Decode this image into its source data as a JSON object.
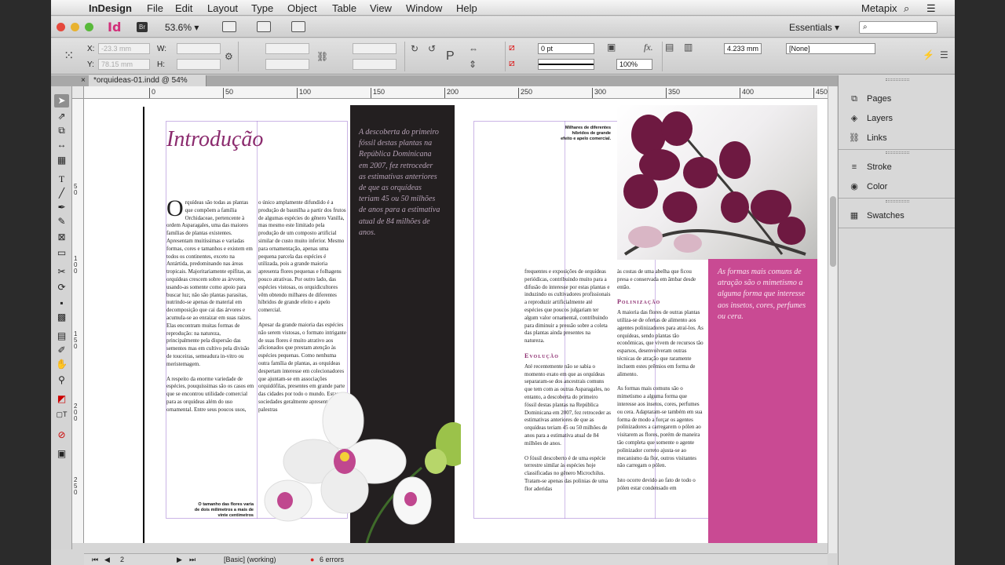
{
  "menubar": {
    "app": "InDesign",
    "items": [
      "File",
      "Edit",
      "Layout",
      "Type",
      "Object",
      "Table",
      "View",
      "Window",
      "Help"
    ],
    "right_app": "Metapix"
  },
  "appbar": {
    "logo": "Id",
    "bridge": "Br",
    "zoom": "53.6%",
    "workspace": "Essentials"
  },
  "control": {
    "x_label": "X:",
    "x_value": "-23.3 mm",
    "y_label": "Y:",
    "y_value": "78.15 mm",
    "w_label": "W:",
    "h_label": "H:",
    "stroke_weight": "0 pt",
    "opacity": "100%",
    "dimension": "4.233 mm",
    "object_style": "[None]"
  },
  "document_tab": "*orquideas-01.indd @ 54%",
  "ruler": {
    "h_ticks": [
      "0",
      "50",
      "100",
      "150",
      "200",
      "250",
      "300",
      "350",
      "400",
      "450"
    ],
    "v_ticks": [
      "5\n0",
      "1\n0\n0",
      "1\n5\n0",
      "2\n0\n0",
      "2\n5\n0"
    ]
  },
  "spread": {
    "title": "Introdução",
    "col1_p1": "rquídeas são todas as plantas que compõem a família Orchidaceae, pertencente à ordem Asparagales, uma das maiores famílias de plantas existentes. Apresentam muitíssimas e variadas formas, cores e tamanhos e existem em todos os continentes, exceto na Antártida, predominando nas áreas tropicais. Majoritariamente epífitas, as orquídeas crescem sobre as árvores, usando-as somente como apoio para buscar luz; não são plantas parasitas, nutrindo-se apenas de material em decomposição que cai das árvores e acumula-se ao enraizar em suas raízes. Elas encontram muitas formas de reprodução: na natureza, principalmente pela dispersão das sementes mas em cultivo pela divisão de touceiras, semeadura in-vitro ou meristemagem.",
    "col1_p2": "A respeito da enorme variedade de espécies, pouquíssimas são os casos em que se encontrou utilidade comercial para as orquídeas além do uso ornamental. Entre seus poucos usos,",
    "col2_p1": "o único amplamente difundido é a produção de baunilha a partir dos frutos de algumas espécies do gênero Vanilla, mas mesmo este limitado pela produção de um composto artificial similar de custo muito inferior. Mesmo para ornamentação, apenas uma pequena parcela das espécies é utilizada, pois a grande maioria apresenta flores pequenas e folhagens pouco atrativas. Por outro lado, das espécies vistosas, os orquidicultores vêm obtendo milhares de diferentes híbridos de grande efeito e apelo comercial.",
    "col2_p2": "Apesar da grande maioria das espécies não serem vistosas, o formato intrigante de suas flores é muito atrativo aos aficionados que prestam atenção às espécies pequenas. Como nenhuma outra família de plantas, as orquídeas despertam interesse em colecionadores que ajuntam-se em associações orquidófilas, presentes em grande parte das cidades por todo o mundo. Estas sociedades geralmente apresentam palestras",
    "caption_left": "O tamanho das flores varia de dois milímetros a mais de vinte centímetros",
    "quote1": "A descoberta do primeiro fóssil destas plantas na República Dominicana em 2007, fez retroceder as estimativas anteriores de que as orquídeas teriam 45 ou 50 milhões de anos para a estimativa atual de 84 milhões de anos.",
    "caption_right": "Milhares de diferentes híbridos de grande efeito e apelo comercial.",
    "col3_p1": "frequentes e exposições de orquídeas periódicas, contribuindo muito para a difusão do interesse por estas plantas e induzindo os cultivadores profissionais a reproduzir artificialmente até espécies que poucos julgariam ter algum valor ornamental, contribuindo para diminuir a pressão sobre a coleta das plantas ainda presentes na natureza.",
    "col3_head": "Evolução",
    "col3_p2": "Até recentemente não se sabia o momento exato em que as orquídeas separaram-se dos ancestrais comuns que tem com as outras Asparagales, no entanto, a descoberta do primeiro fóssil destas plantas na República Dominicana em 2007, fez retroceder as estimativas anteriores de que as orquídeas teriam 45 ou 50 milhões de anos para a estimativa atual de 84 milhões de anos.",
    "col3_p3": "O fóssil descoberto é de uma espécie terrestre similar às espécies hoje classificadas no gênero Microchilus. Tratam-se apenas das polinias de uma flor aderidas",
    "col4_p1": "às costas de uma abelha que ficou presa e conservada em âmbar desde então.",
    "col4_head": "Polinização",
    "col4_p2": "A maioria das flores de outras plantas utiliza-se de ofertas de alimento aos agentes polinizadores para atraí-los. As orquídeas, sendo plantas tão econômicas, que vivem de recursos tão esparsos, desenvolveram outras técnicas de atração que raramente incluem estes prêmios em forma de alimento.",
    "col4_p3": "As formas mais comuns são o mimetismo a alguma forma que interesse aos insetos, cores, perfumes ou cera. Adaptaram-se também em sua forma de modo a forçar os agentes polinizadores a carregarem o pólen ao visitarem as flores, porém de maneira tão completa que somente o agente polinizador correto ajusta-se ao mecanismo da flor, outros visitantes não carregam o pólen.",
    "col4_p4": "Isto ocorre devido ao fato de todo o pólen estar condensado em",
    "quote2": "As formas mais comuns de atração são o mimetismo a alguma forma que interesse aos insetos, cores, perfumes ou cera."
  },
  "status": {
    "page": "2",
    "preflight_profile": "[Basic] (working)",
    "errors": "6 errors"
  },
  "panels": {
    "items": [
      "Pages",
      "Layers",
      "Links",
      "Stroke",
      "Color",
      "Swatches"
    ]
  },
  "colors": {
    "accent_purple": "#8b2b6e",
    "pink_box": "#c94a93",
    "black_band": "#231f20"
  }
}
